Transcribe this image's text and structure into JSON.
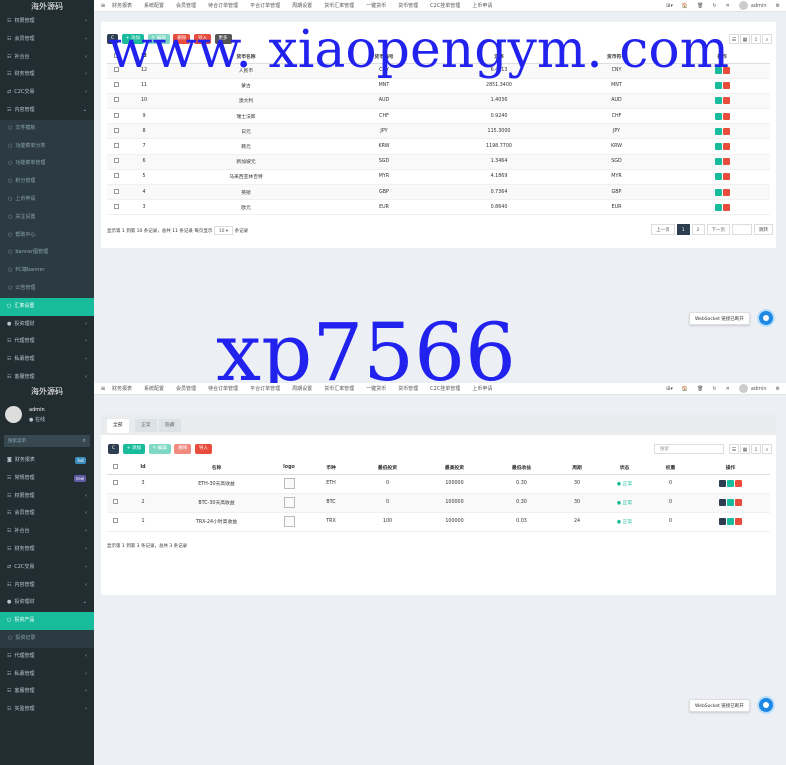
{
  "brand": "海外源码",
  "topnav": {
    "items": [
      "财务报表",
      "系统配置",
      "会员管理",
      "待合订单管理",
      "平合订单管理",
      "周期设置",
      "货币汇率管理",
      "一键货币",
      "货币管理",
      "C2C挂单管理",
      "上币申请"
    ],
    "user": "admin",
    "right_icons": [
      "⊞▾",
      "🏠",
      "🗑",
      "↻",
      "✕"
    ]
  },
  "sidebar_top": {
    "items": [
      {
        "label": "权限管理",
        "icon": "☷",
        "kind": "item",
        "arrow": "‹"
      },
      {
        "label": "会员管理",
        "icon": "☷",
        "kind": "item",
        "arrow": "‹"
      },
      {
        "label": "补合台",
        "icon": "☷",
        "kind": "item",
        "arrow": "‹"
      },
      {
        "label": "财务管理",
        "icon": "☷",
        "kind": "item",
        "arrow": "‹"
      },
      {
        "label": "C2C交易",
        "icon": "⇄",
        "kind": "item",
        "arrow": "‹"
      },
      {
        "label": "内容管理",
        "icon": "☷",
        "kind": "open",
        "arrow": "⌄"
      },
      {
        "label": "文件模板",
        "icon": "○",
        "kind": "sub"
      },
      {
        "label": "功能菜单分类",
        "icon": "○",
        "kind": "sub"
      },
      {
        "label": "功能菜单管理",
        "icon": "○",
        "kind": "sub"
      },
      {
        "label": "积分管理",
        "icon": "○",
        "kind": "sub"
      },
      {
        "label": "上币申请",
        "icon": "○",
        "kind": "sub"
      },
      {
        "label": "关注设置",
        "icon": "○",
        "kind": "sub"
      },
      {
        "label": "帮助中心",
        "icon": "○",
        "kind": "sub"
      },
      {
        "label": "banner图管理",
        "icon": "○",
        "kind": "sub"
      },
      {
        "label": "PC端banner",
        "icon": "○",
        "kind": "sub"
      },
      {
        "label": "公告管理",
        "icon": "○",
        "kind": "sub"
      },
      {
        "label": "汇率设置",
        "icon": "○",
        "kind": "active"
      },
      {
        "label": "投资理财",
        "icon": "●",
        "kind": "item",
        "arrow": "‹"
      },
      {
        "label": "代理管理",
        "icon": "☷",
        "kind": "item",
        "arrow": "‹"
      },
      {
        "label": "私募管理",
        "icon": "☷",
        "kind": "item",
        "arrow": "‹"
      },
      {
        "label": "客服管理",
        "icon": "☷",
        "kind": "item",
        "arrow": "‹"
      },
      {
        "label": "实盈管理",
        "icon": "☷",
        "kind": "item",
        "arrow": "‹"
      }
    ]
  },
  "currency": {
    "toolbar": {
      "refresh": "C",
      "add": "+ 添加",
      "edit": "✎ 编辑",
      "delete": "删除",
      "import": "导入",
      "more": "更多"
    },
    "headers": [
      "",
      "Id",
      "货币名称",
      "货币编号",
      "汇率",
      "货币符号",
      "操作"
    ],
    "rows": [
      {
        "id": "12",
        "name": "人民币",
        "code": "CNY",
        "rate": "6.4713",
        "symbol": "CNY"
      },
      {
        "id": "11",
        "name": "蒙古",
        "code": "MNT",
        "rate": "2851.3400",
        "symbol": "MNT"
      },
      {
        "id": "10",
        "name": "澳大利",
        "code": "AUD",
        "rate": "1.4036",
        "symbol": "AUD"
      },
      {
        "id": "9",
        "name": "瑞士法郎",
        "code": "CHF",
        "rate": "0.9240",
        "symbol": "CHF"
      },
      {
        "id": "8",
        "name": "日元",
        "code": "JPY",
        "rate": "115.3000",
        "symbol": "JPY"
      },
      {
        "id": "7",
        "name": "韩元",
        "code": "KRW",
        "rate": "1198.7700",
        "symbol": "KRW"
      },
      {
        "id": "6",
        "name": "新加坡元",
        "code": "SGD",
        "rate": "1.3464",
        "symbol": "SGD"
      },
      {
        "id": "5",
        "name": "马来西亚林吉特",
        "code": "MYR",
        "rate": "4.1869",
        "symbol": "MYR"
      },
      {
        "id": "4",
        "name": "英镑",
        "code": "GBP",
        "rate": "0.7364",
        "symbol": "GBP"
      },
      {
        "id": "3",
        "name": "欧元",
        "code": "EUR",
        "rate": "0.8640",
        "symbol": "EUR"
      }
    ],
    "footer_a": "显示第 1 到第 10 条记录，总共 11 条记录 每页显示",
    "page_size": "10 ▾",
    "footer_b": "条记录",
    "pager": {
      "prev": "上一页",
      "p1": "1",
      "p2": "2",
      "next": "下一页",
      "go": "跳转"
    }
  },
  "ws_text": "WebSocket 链接已断开",
  "watermark": {
    "line1": "www. xiaopengym. com",
    "line2": "xp7566"
  },
  "sidebar_bottom": {
    "user_name": "admin",
    "status": "● 在线",
    "search_placeholder": "搜索菜单",
    "items": [
      {
        "label": "财务报表",
        "icon": "◙",
        "kind": "item",
        "badge": "hot",
        "badge_color": "#3c8dbc"
      },
      {
        "label": "常规管理",
        "icon": "☷",
        "kind": "item",
        "badge": "new",
        "badge_color": "#605ca8"
      },
      {
        "label": "权限管理",
        "icon": "☷",
        "kind": "item",
        "arrow": "‹"
      },
      {
        "label": "会员管理",
        "icon": "☷",
        "kind": "item",
        "arrow": "‹"
      },
      {
        "label": "补合台",
        "icon": "☷",
        "kind": "item",
        "arrow": "‹"
      },
      {
        "label": "财务管理",
        "icon": "☷",
        "kind": "item",
        "arrow": "‹"
      },
      {
        "label": "C2C交易",
        "icon": "⇄",
        "kind": "item",
        "arrow": "‹"
      },
      {
        "label": "内容管理",
        "icon": "☷",
        "kind": "item",
        "arrow": "‹"
      },
      {
        "label": "投资理财",
        "icon": "●",
        "kind": "open",
        "arrow": "⌄"
      },
      {
        "label": "投资产品",
        "icon": "○",
        "kind": "active"
      },
      {
        "label": "投资记录",
        "icon": "○",
        "kind": "sub"
      },
      {
        "label": "代理管理",
        "icon": "☷",
        "kind": "item",
        "arrow": "‹"
      },
      {
        "label": "私募管理",
        "icon": "☷",
        "kind": "item",
        "arrow": "‹"
      },
      {
        "label": "客服管理",
        "icon": "☷",
        "kind": "item",
        "arrow": "‹"
      },
      {
        "label": "实盈管理",
        "icon": "☷",
        "kind": "item",
        "arrow": "‹"
      }
    ]
  },
  "products": {
    "tabs": [
      "全部",
      "正常",
      "隐藏"
    ],
    "toolbar": {
      "refresh": "C",
      "add": "+ 添加",
      "edit": "✎ 编辑",
      "delete": "删除",
      "import": "导入"
    },
    "search_placeholder": "搜索",
    "headers": [
      "",
      "Id",
      "名称",
      "logo",
      "币种",
      "最低投资",
      "最高投资",
      "最低收益",
      "周期",
      "状态",
      "权重",
      "操作"
    ],
    "rows": [
      {
        "id": "3",
        "name": "ETH-30天高收益",
        "coin": "ETH",
        "min": "0",
        "max": "100000",
        "income": "0.30",
        "period": "30",
        "status": "● 正常",
        "weight": "0"
      },
      {
        "id": "2",
        "name": "BTC-30天高收益",
        "coin": "BTC",
        "min": "0",
        "max": "100000",
        "income": "0.30",
        "period": "30",
        "status": "● 正常",
        "weight": "0"
      },
      {
        "id": "1",
        "name": "TRX-24小时高收益",
        "coin": "TRX",
        "min": "100",
        "max": "100000",
        "income": "0.03",
        "period": "24",
        "status": "● 正常",
        "weight": "0"
      }
    ],
    "footer": "显示第 1 到第 3 条记录，总共 3 条记录"
  },
  "colors": {
    "sidebar": "#222d32",
    "accent": "#18bc9c",
    "danger": "#e74c3c",
    "primary_dark": "#2c3e50",
    "warning": "#f39c12"
  }
}
